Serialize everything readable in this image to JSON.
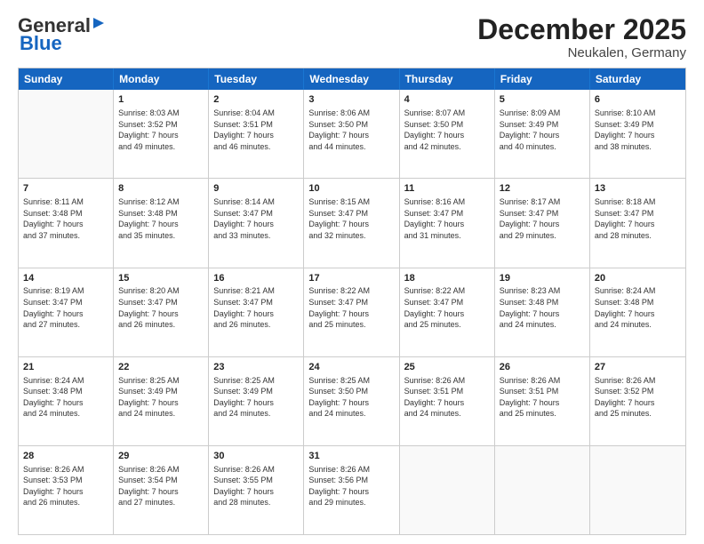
{
  "header": {
    "logo_general": "General",
    "logo_blue": "Blue",
    "month": "December 2025",
    "location": "Neukalen, Germany"
  },
  "weekdays": [
    "Sunday",
    "Monday",
    "Tuesday",
    "Wednesday",
    "Thursday",
    "Friday",
    "Saturday"
  ],
  "rows": [
    [
      {
        "day": "",
        "text": ""
      },
      {
        "day": "1",
        "text": "Sunrise: 8:03 AM\nSunset: 3:52 PM\nDaylight: 7 hours\nand 49 minutes."
      },
      {
        "day": "2",
        "text": "Sunrise: 8:04 AM\nSunset: 3:51 PM\nDaylight: 7 hours\nand 46 minutes."
      },
      {
        "day": "3",
        "text": "Sunrise: 8:06 AM\nSunset: 3:50 PM\nDaylight: 7 hours\nand 44 minutes."
      },
      {
        "day": "4",
        "text": "Sunrise: 8:07 AM\nSunset: 3:50 PM\nDaylight: 7 hours\nand 42 minutes."
      },
      {
        "day": "5",
        "text": "Sunrise: 8:09 AM\nSunset: 3:49 PM\nDaylight: 7 hours\nand 40 minutes."
      },
      {
        "day": "6",
        "text": "Sunrise: 8:10 AM\nSunset: 3:49 PM\nDaylight: 7 hours\nand 38 minutes."
      }
    ],
    [
      {
        "day": "7",
        "text": "Sunrise: 8:11 AM\nSunset: 3:48 PM\nDaylight: 7 hours\nand 37 minutes."
      },
      {
        "day": "8",
        "text": "Sunrise: 8:12 AM\nSunset: 3:48 PM\nDaylight: 7 hours\nand 35 minutes."
      },
      {
        "day": "9",
        "text": "Sunrise: 8:14 AM\nSunset: 3:47 PM\nDaylight: 7 hours\nand 33 minutes."
      },
      {
        "day": "10",
        "text": "Sunrise: 8:15 AM\nSunset: 3:47 PM\nDaylight: 7 hours\nand 32 minutes."
      },
      {
        "day": "11",
        "text": "Sunrise: 8:16 AM\nSunset: 3:47 PM\nDaylight: 7 hours\nand 31 minutes."
      },
      {
        "day": "12",
        "text": "Sunrise: 8:17 AM\nSunset: 3:47 PM\nDaylight: 7 hours\nand 29 minutes."
      },
      {
        "day": "13",
        "text": "Sunrise: 8:18 AM\nSunset: 3:47 PM\nDaylight: 7 hours\nand 28 minutes."
      }
    ],
    [
      {
        "day": "14",
        "text": "Sunrise: 8:19 AM\nSunset: 3:47 PM\nDaylight: 7 hours\nand 27 minutes."
      },
      {
        "day": "15",
        "text": "Sunrise: 8:20 AM\nSunset: 3:47 PM\nDaylight: 7 hours\nand 26 minutes."
      },
      {
        "day": "16",
        "text": "Sunrise: 8:21 AM\nSunset: 3:47 PM\nDaylight: 7 hours\nand 26 minutes."
      },
      {
        "day": "17",
        "text": "Sunrise: 8:22 AM\nSunset: 3:47 PM\nDaylight: 7 hours\nand 25 minutes."
      },
      {
        "day": "18",
        "text": "Sunrise: 8:22 AM\nSunset: 3:47 PM\nDaylight: 7 hours\nand 25 minutes."
      },
      {
        "day": "19",
        "text": "Sunrise: 8:23 AM\nSunset: 3:48 PM\nDaylight: 7 hours\nand 24 minutes."
      },
      {
        "day": "20",
        "text": "Sunrise: 8:24 AM\nSunset: 3:48 PM\nDaylight: 7 hours\nand 24 minutes."
      }
    ],
    [
      {
        "day": "21",
        "text": "Sunrise: 8:24 AM\nSunset: 3:48 PM\nDaylight: 7 hours\nand 24 minutes."
      },
      {
        "day": "22",
        "text": "Sunrise: 8:25 AM\nSunset: 3:49 PM\nDaylight: 7 hours\nand 24 minutes."
      },
      {
        "day": "23",
        "text": "Sunrise: 8:25 AM\nSunset: 3:49 PM\nDaylight: 7 hours\nand 24 minutes."
      },
      {
        "day": "24",
        "text": "Sunrise: 8:25 AM\nSunset: 3:50 PM\nDaylight: 7 hours\nand 24 minutes."
      },
      {
        "day": "25",
        "text": "Sunrise: 8:26 AM\nSunset: 3:51 PM\nDaylight: 7 hours\nand 24 minutes."
      },
      {
        "day": "26",
        "text": "Sunrise: 8:26 AM\nSunset: 3:51 PM\nDaylight: 7 hours\nand 25 minutes."
      },
      {
        "day": "27",
        "text": "Sunrise: 8:26 AM\nSunset: 3:52 PM\nDaylight: 7 hours\nand 25 minutes."
      }
    ],
    [
      {
        "day": "28",
        "text": "Sunrise: 8:26 AM\nSunset: 3:53 PM\nDaylight: 7 hours\nand 26 minutes."
      },
      {
        "day": "29",
        "text": "Sunrise: 8:26 AM\nSunset: 3:54 PM\nDaylight: 7 hours\nand 27 minutes."
      },
      {
        "day": "30",
        "text": "Sunrise: 8:26 AM\nSunset: 3:55 PM\nDaylight: 7 hours\nand 28 minutes."
      },
      {
        "day": "31",
        "text": "Sunrise: 8:26 AM\nSunset: 3:56 PM\nDaylight: 7 hours\nand 29 minutes."
      },
      {
        "day": "",
        "text": ""
      },
      {
        "day": "",
        "text": ""
      },
      {
        "day": "",
        "text": ""
      }
    ]
  ]
}
